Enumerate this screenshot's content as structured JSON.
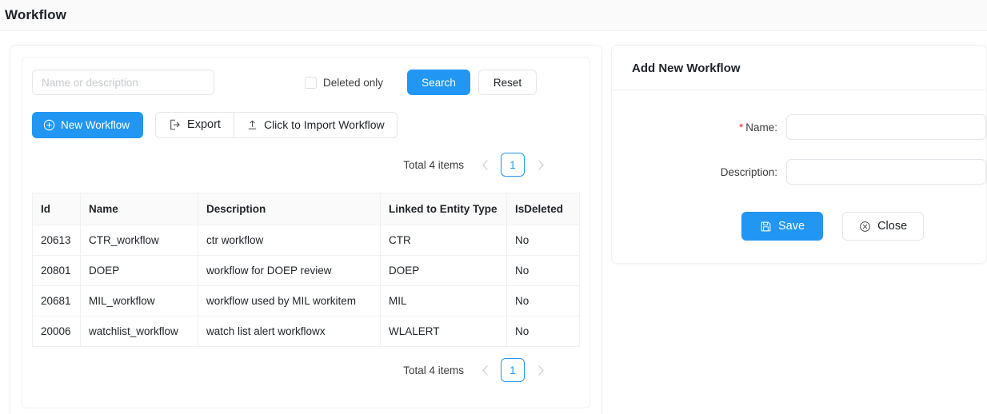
{
  "header": {
    "title": "Workflow"
  },
  "search": {
    "placeholder": "Name or description",
    "value": "",
    "deleted_only_label": "Deleted only",
    "deleted_only_checked": false,
    "search_label": "Search",
    "reset_label": "Reset"
  },
  "actions": {
    "new_workflow_label": "New Workflow",
    "new_workflow_icon": "plus-circle-icon",
    "export_label": "Export",
    "export_icon": "export-icon",
    "import_label": "Click to Import Workflow",
    "import_icon": "upload-icon"
  },
  "pagination": {
    "total_label": "Total 4 items",
    "prev_icon": "chevron-left-icon",
    "next_icon": "chevron-right-icon",
    "current_page": "1"
  },
  "table": {
    "columns": [
      "Id",
      "Name",
      "Description",
      "Linked to Entity Type",
      "IsDeleted"
    ],
    "rows": [
      {
        "id": "20613",
        "name": "CTR_workflow",
        "description": "ctr workflow",
        "entity_type": "CTR",
        "is_deleted": "No"
      },
      {
        "id": "20801",
        "name": "DOEP",
        "description": "workflow for DOEP review",
        "entity_type": "DOEP",
        "is_deleted": "No"
      },
      {
        "id": "20681",
        "name": "MIL_workflow",
        "description": "workflow used by MIL workitem",
        "entity_type": "MIL",
        "is_deleted": "No"
      },
      {
        "id": "20006",
        "name": "watchlist_workflow",
        "description": "watch list alert workflowx",
        "entity_type": "WLALERT",
        "is_deleted": "No"
      }
    ]
  },
  "panel": {
    "title": "Add New Workflow",
    "name_required_marker": "*",
    "name_label": "Name:",
    "name_value": "",
    "description_label": "Description:",
    "description_value": "",
    "save_label": "Save",
    "save_icon": "save-icon",
    "close_label": "Close",
    "close_icon": "close-circle-icon"
  },
  "colors": {
    "primary": "#2196f3",
    "link": "#2196f3",
    "required": "#f5222d",
    "header_bg": "#fafafa",
    "border": "#f0f0f0"
  }
}
